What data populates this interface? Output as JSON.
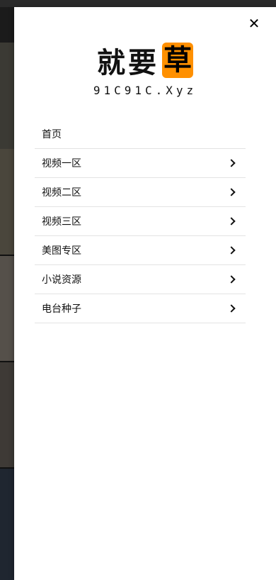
{
  "drawer": {
    "close_icon": "close-icon",
    "close_glyph": "✕",
    "logo": {
      "text_part": "就要",
      "boxed_part": "草",
      "subtitle": "91C91C.Xyz",
      "accent_color": "#ff9000"
    },
    "menu": [
      {
        "label": "首页",
        "has_chevron": false
      },
      {
        "label": "视频一区",
        "has_chevron": true
      },
      {
        "label": "视频二区",
        "has_chevron": true
      },
      {
        "label": "视频三区",
        "has_chevron": true
      },
      {
        "label": "美图专区",
        "has_chevron": true
      },
      {
        "label": "小说资源",
        "has_chevron": true
      },
      {
        "label": "电台种子",
        "has_chevron": true
      }
    ]
  }
}
